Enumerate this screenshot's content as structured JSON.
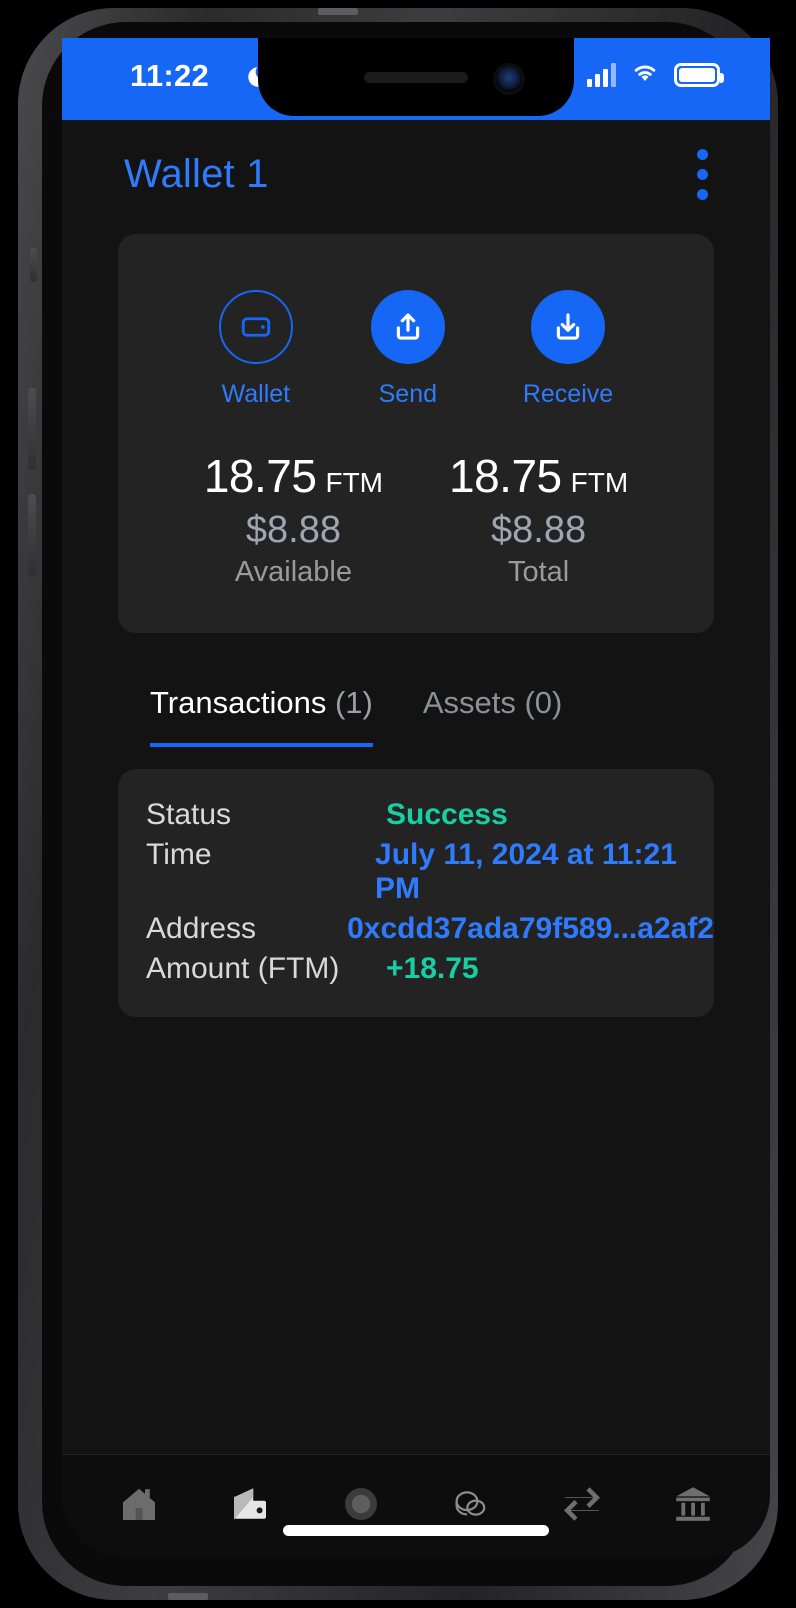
{
  "status_bar": {
    "time": "11:22",
    "dnd_icon": "moon-icon",
    "signal_icon": "cellular-signal-icon",
    "wifi_icon": "wifi-icon",
    "battery_icon": "battery-full-icon"
  },
  "header": {
    "title": "Wallet 1",
    "menu_icon": "overflow-menu-icon"
  },
  "actions": [
    {
      "label": "Wallet",
      "icon": "wallet-icon",
      "style": "outline"
    },
    {
      "label": "Send",
      "icon": "upload-icon",
      "style": "filled"
    },
    {
      "label": "Receive",
      "icon": "download-icon",
      "style": "filled"
    }
  ],
  "balances": [
    {
      "amount": "18.75",
      "ticker": "FTM",
      "fiat": "$8.88",
      "caption": "Available"
    },
    {
      "amount": "18.75",
      "ticker": "FTM",
      "fiat": "$8.88",
      "caption": "Total"
    }
  ],
  "tabs": [
    {
      "label": "Transactions",
      "count": "(1)",
      "active": true
    },
    {
      "label": "Assets",
      "count": "(0)",
      "active": false
    }
  ],
  "transaction": {
    "rows": [
      {
        "label": "Status",
        "value": "Success"
      },
      {
        "label": "Time",
        "value": "July 11, 2024 at 11:21 PM"
      },
      {
        "label": "Address",
        "value": "0xcdd37ada79f589...a2af2"
      },
      {
        "label": "Amount (FTM)",
        "value": "+18.75"
      }
    ]
  },
  "bottom_nav": [
    {
      "icon": "home-icon",
      "active": false
    },
    {
      "icon": "wallet-icon",
      "active": true
    },
    {
      "icon": "settings-icon",
      "active": false
    },
    {
      "icon": "coins-icon",
      "active": false
    },
    {
      "icon": "swap-icon",
      "active": false
    },
    {
      "icon": "bank-icon",
      "active": false
    }
  ],
  "colors": {
    "accent_blue": "#1667f5",
    "link_blue": "#2f7bfb",
    "success_green": "#17cfa4",
    "card_bg": "#232323",
    "page_bg": "#131313"
  }
}
